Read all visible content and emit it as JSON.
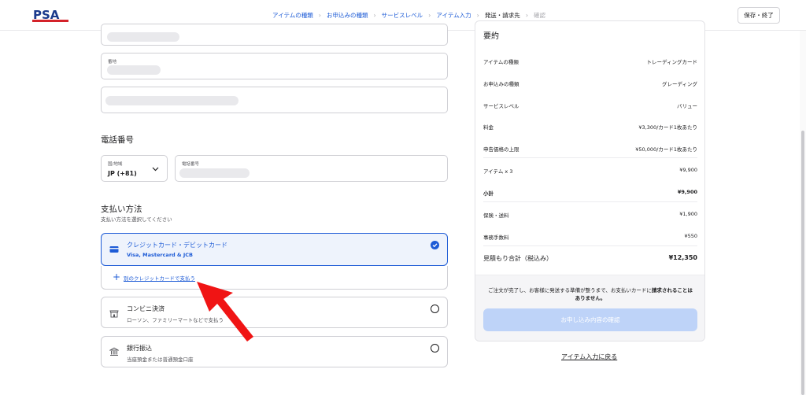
{
  "header": {
    "logo_text": "PSA",
    "breadcrumbs": [
      {
        "label": "アイテムの種類"
      },
      {
        "label": "お申込みの種類"
      },
      {
        "label": "サービスレベル"
      },
      {
        "label": "アイテム入力"
      },
      {
        "label": "発送・請求先"
      },
      {
        "label": "確認"
      }
    ],
    "save_label": "保存・終了"
  },
  "address": {
    "street_label": "番地"
  },
  "phone": {
    "section_title": "電話番号",
    "country_label": "国/地域",
    "country_value": "JP (+81)",
    "number_label": "電話番号"
  },
  "payment": {
    "section_title": "支払い方法",
    "section_subtitle": "支払い方法を選択してください",
    "options": [
      {
        "title": "クレジットカード・デビットカード",
        "subtitle": "Visa, Mastercard & JCB"
      },
      {
        "title": "コンビニ決済",
        "subtitle": "ローソン、ファミリーマートなどで支払う"
      },
      {
        "title": "銀行振込",
        "subtitle": "当座預金または普通預金口座"
      }
    ],
    "add_card_label": "別のクレジットカードで支払う"
  },
  "summary": {
    "title": "要約",
    "rows": [
      {
        "label": "アイテムの種類",
        "value": "トレーディングカード"
      },
      {
        "label": "お申込みの種類",
        "value": "グレーディング"
      },
      {
        "label": "サービスレベル",
        "value": "バリュー"
      },
      {
        "label": "料金",
        "value": "¥3,300/カード1枚あたり"
      },
      {
        "label": "申告価格の上限",
        "value": "¥50,000/カード1枚あたり"
      },
      {
        "label": "アイテム x 3",
        "value": "¥9,900"
      },
      {
        "label": "小計",
        "value": "¥9,900"
      },
      {
        "label": "保険・送料",
        "value": "¥1,900"
      },
      {
        "label": "事務手数料",
        "value": "¥550"
      },
      {
        "label": "見積もり合計（税込み）",
        "value": "¥12,350"
      }
    ],
    "note_prefix": "ご注文が完了し、お客様に発送する準備が整うまで、お支払いカードに",
    "note_bold": "請求されることはありません。",
    "confirm_label": "お申し込み内容の確認"
  },
  "back_link": "アイテム入力に戻る",
  "colors": {
    "accent": "#1d5bd6",
    "selected_bg": "#eef3fc",
    "disabled_button": "#bed3f8",
    "annotation_arrow": "#f01414"
  }
}
